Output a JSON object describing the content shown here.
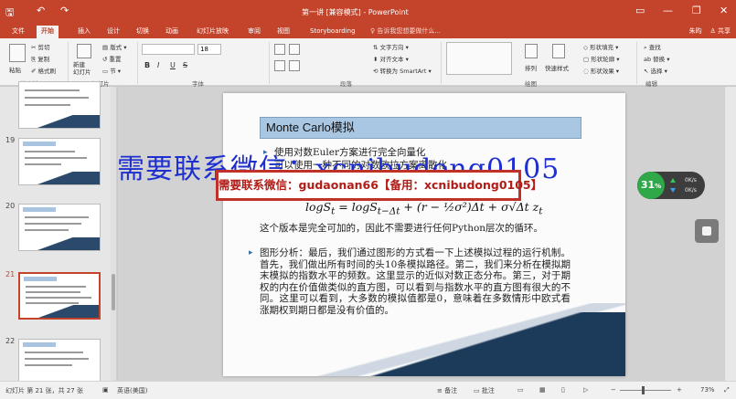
{
  "titlebar": {
    "window_title": "第一讲 [兼容模式] - PowerPoint",
    "undo_glyph": "↶",
    "redo_glyph": "↷",
    "save_glyph": "🖫",
    "minimize": "—",
    "restore": "❐",
    "close": "✕",
    "ribbon_display_glyph": "▭"
  },
  "tabs": [
    {
      "label": "文件"
    },
    {
      "label": "开始",
      "active": true
    },
    {
      "label": "插入"
    },
    {
      "label": "设计"
    },
    {
      "label": "切换"
    },
    {
      "label": "动画"
    },
    {
      "label": "幻灯片放映"
    },
    {
      "label": "审阅"
    },
    {
      "label": "视图"
    },
    {
      "label": "Storyboarding"
    }
  ],
  "tellme": "♀ 告诉我您想要做什么...",
  "account": {
    "user": "朱昀",
    "share": "♙ 共享"
  },
  "ribbon": {
    "clipboard": {
      "paste": "粘贴",
      "cut": "✂ 剪切",
      "copy": "⎘ 复制",
      "painter": "✐ 格式刷",
      "label": "剪贴板"
    },
    "slides": {
      "new": "新建\n幻灯片",
      "layout": "▤ 版式 ▾",
      "reset": "↺ 重置",
      "section": "▭ 节 ▾",
      "label": "幻灯片"
    },
    "font": {
      "size": "18",
      "bold": "B",
      "italic": "I",
      "underline": "U",
      "strike": "S",
      "label": "字体"
    },
    "paragraph": {
      "text_direction": "⇅ 文字方向 ▾",
      "align_text": "⬍ 对齐文本 ▾",
      "smartart": "⟲ 转换为 SmartArt ▾",
      "label": "段落"
    },
    "drawing": {
      "arrange": "排列",
      "quick_styles": "快速样式",
      "fill": "◇ 形状填充 ▾",
      "outline": "▢ 形状轮廓 ▾",
      "effects": "◌ 形状效果 ▾",
      "label": "绘图"
    },
    "editing": {
      "find": "⌕ 查找",
      "replace": "ab 替换 ▾",
      "select": "↖ 选择 ▾",
      "label": "编辑"
    }
  },
  "thumbnails": [
    {
      "num": "19"
    },
    {
      "num": "20"
    },
    {
      "num": "21",
      "active": true
    },
    {
      "num": "22"
    }
  ],
  "slide": {
    "title": "Monte Carlo模拟",
    "bullet1": "使用对数Euler方案进行完全向量化",
    "bullet1_cont": "可以使用一种不同的对数欧拉方案离散化",
    "formula_left": "logS",
    "formula_sub1": "t",
    "formula_eq": " = logS",
    "formula_sub2": "t−Δt",
    "formula_rest": " + (r − ½σ²)Δt + σ√Δt z",
    "formula_sub3": "t",
    "para": "这个版本是完全可加的，因此不需要进行任何Python层次的循环。",
    "bullet2": "图形分析：最后，我们通过图形的方式看一下上述模拟过程的运行机制。首先，我们做出所有时间的头10条模拟路径。第二，我们来分析在模拟期末模拟的指数水平的频数。这里显示的近似对数正态分布。第三，对于期权的内在价值做类似的直方图，可以看到与指数水平的直方图有很大的不同。这里可以看到，大多数的模拟值都是0，意味着在多数情形中欧式看涨期权到期日都是没有价值的。"
  },
  "watermarks": {
    "big": "需要联系微信：xcnibudong0105",
    "box": "需要联系微信：gudaonan66【备用：xcnibudong0105】"
  },
  "speed_widget": {
    "percent": "31",
    "unit": "%",
    "up": "0K/s",
    "down": "0K/s"
  },
  "status": {
    "slide_info": "幻灯片 第 21 张，共 27 张",
    "lang": "英语(美国)",
    "notes": "≡ 备注",
    "comments": "▭ 批注",
    "zoom_minus": "−",
    "zoom_plus": "+",
    "zoom": "73%"
  },
  "colors": {
    "accent": "#c4432b",
    "watermark_blue": "#1e2fd0",
    "watermark_red": "#b21c16"
  }
}
